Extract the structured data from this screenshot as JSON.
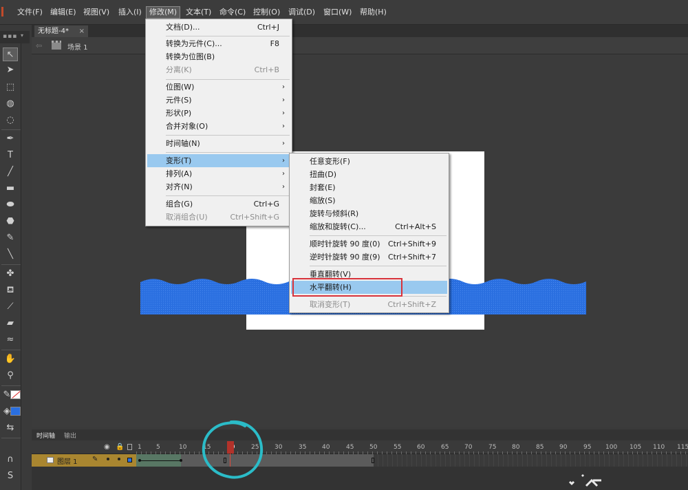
{
  "menubar": {
    "items": [
      "文件(F)",
      "编辑(E)",
      "视图(V)",
      "插入(I)",
      "修改(M)",
      "文本(T)",
      "命令(C)",
      "控制(O)",
      "调试(D)",
      "窗口(W)",
      "帮助(H)"
    ],
    "active": "修改(M)"
  },
  "document": {
    "tab_title": "无标题-4*",
    "close": "×"
  },
  "scene": {
    "back": "⇦",
    "label": "场景 1"
  },
  "modify_menu": {
    "items": [
      {
        "label": "文档(D)...",
        "shortcut": "Ctrl+J"
      },
      {
        "label": "转换为元件(C)...",
        "shortcut": "F8"
      },
      {
        "label": "转换为位图(B)",
        "shortcut": ""
      },
      {
        "label": "分离(K)",
        "shortcut": "Ctrl+B",
        "disabled": true
      },
      {
        "label": "位图(W)",
        "submenu": true
      },
      {
        "label": "元件(S)",
        "submenu": true
      },
      {
        "label": "形状(P)",
        "submenu": true
      },
      {
        "label": "合并对象(O)",
        "submenu": true
      },
      {
        "label": "时间轴(N)",
        "submenu": true
      },
      {
        "label": "变形(T)",
        "submenu": true,
        "highlighted": true
      },
      {
        "label": "排列(A)",
        "submenu": true
      },
      {
        "label": "对齐(N)",
        "submenu": true
      },
      {
        "label": "组合(G)",
        "shortcut": "Ctrl+G"
      },
      {
        "label": "取消组合(U)",
        "shortcut": "Ctrl+Shift+G",
        "disabled": true
      }
    ],
    "submenu_arrow": "›"
  },
  "transform_submenu": {
    "items": [
      {
        "label": "任意变形(F)",
        "shortcut": ""
      },
      {
        "label": "扭曲(D)",
        "shortcut": ""
      },
      {
        "label": "封套(E)",
        "shortcut": ""
      },
      {
        "label": "缩放(S)",
        "shortcut": ""
      },
      {
        "label": "旋转与倾斜(R)",
        "shortcut": ""
      },
      {
        "label": "缩放和旋转(C)...",
        "shortcut": "Ctrl+Alt+S"
      },
      {
        "label": "顺时针旋转 90 度(0)",
        "shortcut": "Ctrl+Shift+9"
      },
      {
        "label": "逆时针旋转 90 度(9)",
        "shortcut": "Ctrl+Shift+7"
      },
      {
        "label": "垂直翻转(V)",
        "shortcut": ""
      },
      {
        "label": "水平翻转(H)",
        "shortcut": "",
        "highlighted": true
      },
      {
        "label": "取消变形(T)",
        "shortcut": "Ctrl+Shift+Z",
        "disabled": true
      }
    ]
  },
  "timeline": {
    "tabs": [
      "时间轴",
      "输出"
    ],
    "frame_numbers": [
      "1",
      "5",
      "10",
      "15",
      "20",
      "25",
      "30",
      "35",
      "40",
      "45",
      "50",
      "55",
      "60",
      "65",
      "70",
      "75",
      "80",
      "85",
      "90",
      "95",
      "100",
      "105",
      "110",
      "115"
    ],
    "current_frame": 20,
    "layer": {
      "name": "图层 1"
    }
  },
  "colors": {
    "accent": "#99c9ef",
    "wave_fill": "#2a6fe0",
    "highlight_box": "#d8323a",
    "annotation": "#2bbcc8"
  },
  "toolbar_icons": [
    "selection-icon",
    "subselection-icon",
    "free-transform-icon",
    "3d-rotation-icon",
    "lasso-icon",
    "pen-icon",
    "text-icon",
    "line-icon",
    "rectangle-icon",
    "oval-icon",
    "polystar-icon",
    "pencil-icon",
    "brush-icon",
    "bone-icon",
    "paint-bucket-icon",
    "eyedropper-icon",
    "eraser-icon",
    "width-icon",
    "hand-icon",
    "zoom-icon"
  ]
}
